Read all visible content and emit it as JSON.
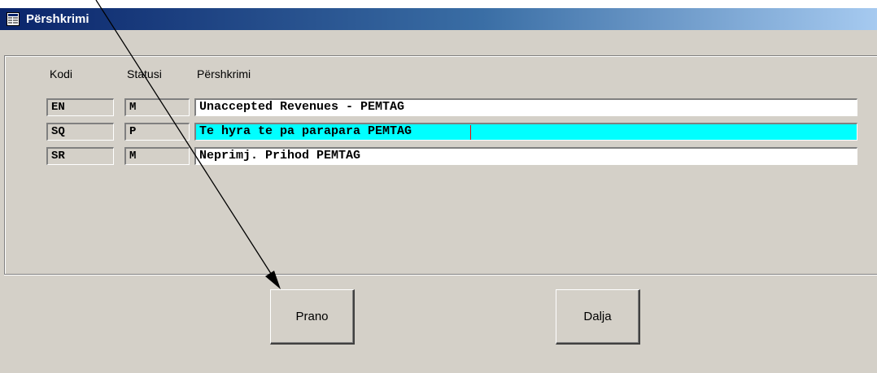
{
  "window": {
    "title": "Përshkrimi",
    "icon": "form-document-icon"
  },
  "table": {
    "headers": {
      "code": "Kodi",
      "status": "Statusi",
      "description": "Përshkrimi"
    },
    "rows": [
      {
        "code": "EN",
        "status": "M",
        "description": "Unaccepted Revenues - PEMTAG",
        "highlight": false
      },
      {
        "code": "SQ",
        "status": "P",
        "description": "Te hyra te pa parapara PEMTAG",
        "highlight": true
      },
      {
        "code": "SR",
        "status": "M",
        "description": "Neprimj. Prihod PEMTAG",
        "highlight": false
      }
    ]
  },
  "buttons": {
    "accept": "Prano",
    "exit": "Dalja"
  },
  "annotation": {
    "type": "arrow",
    "description": "pointer to accept button"
  },
  "colors": {
    "highlight_row": "#00ffff",
    "caret": "#ff0000",
    "titlebar_start": "#0a246a",
    "titlebar_end": "#a6caf0"
  }
}
